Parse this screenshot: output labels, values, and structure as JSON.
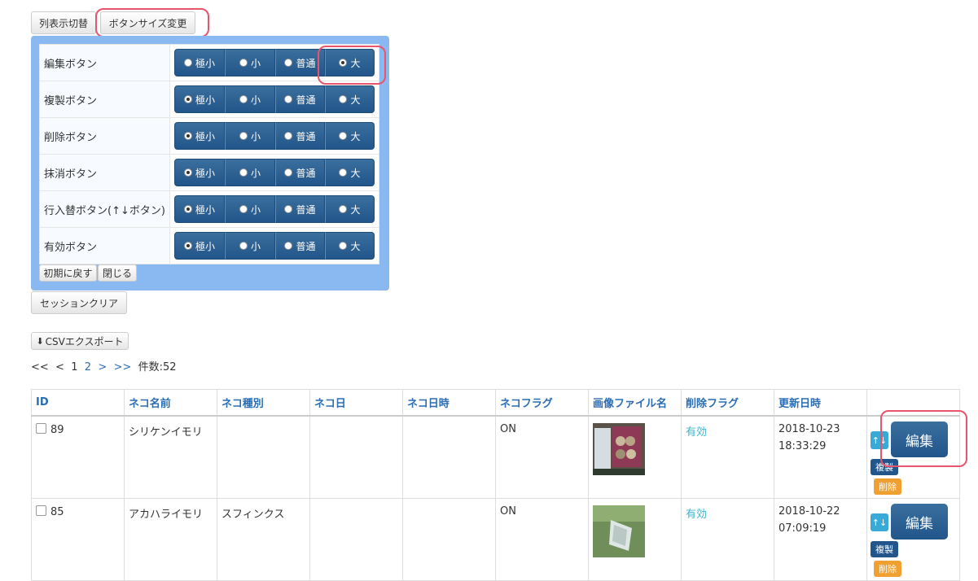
{
  "toolbar": {
    "toggle_columns": "列表示切替",
    "button_size": "ボタンサイズ変更"
  },
  "size_panel": {
    "rows": [
      {
        "label": "編集ボタン",
        "selected": 3
      },
      {
        "label": "複製ボタン",
        "selected": 0
      },
      {
        "label": "削除ボタン",
        "selected": 0
      },
      {
        "label": "抹消ボタン",
        "selected": 0
      },
      {
        "label": "行入替ボタン(↑↓ボタン)",
        "selected": 0
      },
      {
        "label": "有効ボタン",
        "selected": 0
      }
    ],
    "options": [
      "極小",
      "小",
      "普通",
      "大"
    ],
    "reset": "初期に戻す",
    "close": "閉じる"
  },
  "session_clear": "セッションクリア",
  "csv_export": "CSVエクスポート",
  "pager": {
    "first": "<<",
    "prev": "<",
    "page1": "1",
    "page2": "2",
    "next": ">",
    "last": ">>",
    "count": "件数:52"
  },
  "grid": {
    "headers": [
      "ID",
      "ネコ名前",
      "ネコ種別",
      "ネコ日",
      "ネコ日時",
      "ネコフラグ",
      "画像ファイル名",
      "削除フラグ",
      "更新日時",
      ""
    ],
    "rows": [
      {
        "id": "89",
        "name": "シリケンイモリ",
        "type": "",
        "day": "",
        "datetime": "",
        "flag": "ON",
        "del_flag": "有効",
        "updated_date": "2018-10-23",
        "updated_time": "18:33:29"
      },
      {
        "id": "85",
        "name": "アカハライモリ",
        "type": "スフィンクス",
        "day": "",
        "datetime": "",
        "flag": "ON",
        "del_flag": "有効",
        "updated_date": "2018-10-22",
        "updated_time": "07:09:19"
      }
    ],
    "edit": "編集",
    "copy": "複製",
    "delete": "削除",
    "swap": "↑↓"
  }
}
